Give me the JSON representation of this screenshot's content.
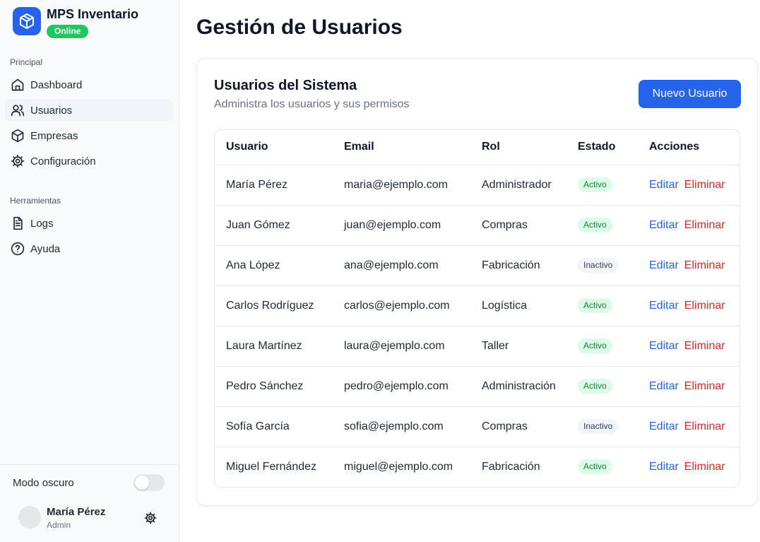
{
  "brand": {
    "title": "MPS Inventario",
    "status": "Online",
    "logo_icon": "cube-icon"
  },
  "sidebar": {
    "sections": [
      {
        "label": "Principal",
        "items": [
          {
            "label": "Dashboard",
            "icon": "home-icon"
          },
          {
            "label": "Usuarios",
            "icon": "users-icon",
            "active": true
          },
          {
            "label": "Empresas",
            "icon": "box-icon"
          },
          {
            "label": "Configuración",
            "icon": "gear-icon"
          }
        ]
      },
      {
        "label": "Herramientas",
        "items": [
          {
            "label": "Logs",
            "icon": "document-icon"
          },
          {
            "label": "Ayuda",
            "icon": "help-icon"
          }
        ]
      }
    ],
    "dark_mode_label": "Modo oscuro",
    "dark_mode_on": false,
    "user": {
      "name": "María Pérez",
      "role": "Admin"
    }
  },
  "page": {
    "title": "Gestión de Usuarios"
  },
  "card": {
    "title": "Usuarios del Sistema",
    "subtitle": "Administra los usuarios y sus permisos",
    "new_button": "Nuevo Usuario"
  },
  "table": {
    "headers": [
      "Usuario",
      "Email",
      "Rol",
      "Estado",
      "Acciones"
    ],
    "edit_label": "Editar",
    "delete_label": "Eliminar",
    "rows": [
      {
        "user": "María Pérez",
        "email": "maria@ejemplo.com",
        "role": "Administrador",
        "status": "Activo"
      },
      {
        "user": "Juan Gómez",
        "email": "juan@ejemplo.com",
        "role": "Compras",
        "status": "Activo"
      },
      {
        "user": "Ana López",
        "email": "ana@ejemplo.com",
        "role": "Fabricación",
        "status": "Inactivo"
      },
      {
        "user": "Carlos Rodríguez",
        "email": "carlos@ejemplo.com",
        "role": "Logística",
        "status": "Activo"
      },
      {
        "user": "Laura Martínez",
        "email": "laura@ejemplo.com",
        "role": "Taller",
        "status": "Activo"
      },
      {
        "user": "Pedro Sánchez",
        "email": "pedro@ejemplo.com",
        "role": "Administración",
        "status": "Activo"
      },
      {
        "user": "Sofía García",
        "email": "sofia@ejemplo.com",
        "role": "Compras",
        "status": "Inactivo"
      },
      {
        "user": "Miguel Fernández",
        "email": "miguel@ejemplo.com",
        "role": "Fabricación",
        "status": "Activo"
      }
    ]
  },
  "colors": {
    "accent": "#2563eb",
    "active_badge": "#dcfce7",
    "danger": "#dc2626",
    "online": "#22c55e"
  }
}
